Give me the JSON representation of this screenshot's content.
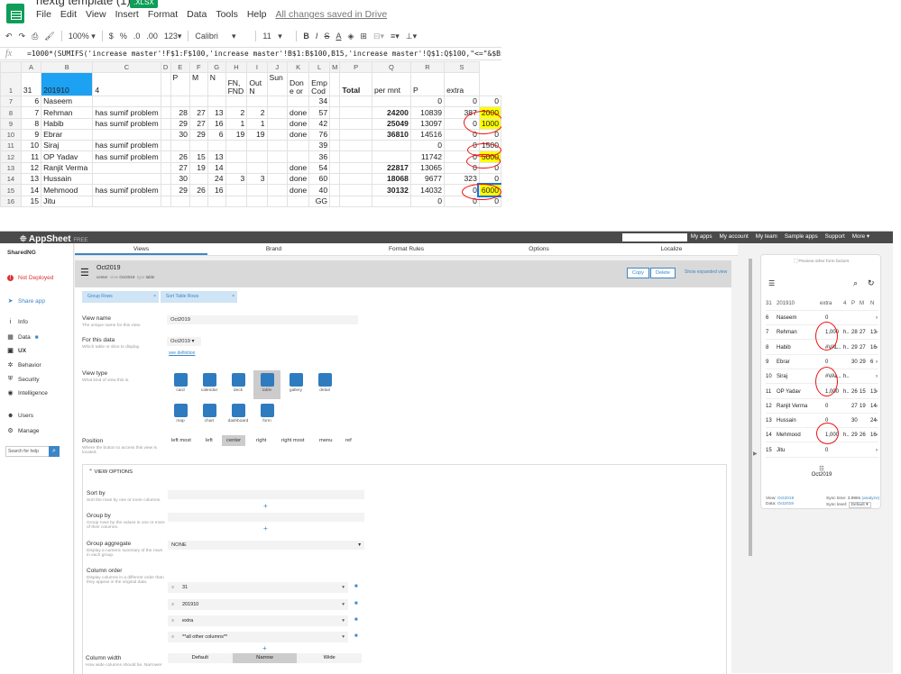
{
  "sheets": {
    "doc_title": "nextg template (1)",
    "doc_ext": ".XLSX",
    "menu": [
      "File",
      "Edit",
      "View",
      "Insert",
      "Format",
      "Data",
      "Tools",
      "Help"
    ],
    "saved_status": "All changes saved in Drive",
    "toolbar": {
      "zoom": "100%",
      "currency": "$",
      "percent": "%",
      "dec_less": ".0",
      "dec_more": ".00",
      "format": "123",
      "font": "Calibri",
      "size": "11",
      "bold": "B",
      "italic": "I",
      "strike": "S",
      "color": "A"
    },
    "formula": "=1000*(SUMIFS('increase master'!F$1:F$100,'increase master'!B$1:B$100,B15,'increase master'!Q$1:Q$100,\"<=\"&$B$1))",
    "columns": [
      "A",
      "B",
      "C",
      "D",
      "E",
      "F",
      "G",
      "H",
      "I",
      "J",
      "K",
      "L",
      "M",
      "P",
      "Q",
      "R",
      "S"
    ],
    "header_row": {
      "rn": "1",
      "A": "31",
      "B": "201910",
      "C": "4",
      "E": "P",
      "F": "M",
      "G": "N",
      "H": "FN, FND",
      "I": "Out N",
      "J": "Sun",
      "K": "Don e or",
      "L": "Emp Cod",
      "P": "Total",
      "Q": "per mnt",
      "R": "P",
      "S": "extra"
    },
    "rows": [
      {
        "rn": "7",
        "A": "6",
        "B": "Naseem",
        "C": "",
        "E": "",
        "F": "",
        "G": "",
        "H": "",
        "I": "",
        "K": "",
        "L": "34",
        "P": "",
        "Q": "0",
        "R": "0",
        "S": "0"
      },
      {
        "rn": "8",
        "A": "7",
        "B": "Rehman",
        "C": "has sumif problem",
        "E": "28",
        "F": "27",
        "G": "13",
        "H": "2",
        "I": "2",
        "K": "done",
        "L": "57",
        "P": "24200",
        "Q": "10839",
        "R": "387",
        "S": "2000"
      },
      {
        "rn": "9",
        "A": "8",
        "B": "Habib",
        "C": "has sumif problem",
        "E": "29",
        "F": "27",
        "G": "16",
        "H": "1",
        "I": "1",
        "K": "done",
        "L": "42",
        "P": "25049",
        "Q": "13097",
        "R": "0",
        "S": "1000"
      },
      {
        "rn": "10",
        "A": "9",
        "B": "Ebrar",
        "C": "",
        "E": "30",
        "F": "29",
        "G": "6",
        "H": "19",
        "I": "19",
        "K": "done",
        "L": "76",
        "P": "36810",
        "Q": "14516",
        "R": "0",
        "S": "0"
      },
      {
        "rn": "11",
        "A": "10",
        "B": "Siraj",
        "C": "has sumif problem",
        "E": "",
        "F": "",
        "G": "",
        "H": "",
        "I": "",
        "K": "",
        "L": "39",
        "P": "",
        "Q": "0",
        "R": "0",
        "S": "1500"
      },
      {
        "rn": "12",
        "A": "11",
        "B": "OP Yadav",
        "C": "has sumif problem",
        "E": "26",
        "F": "15",
        "G": "13",
        "H": "",
        "I": "",
        "K": "",
        "L": "36",
        "P": "",
        "Q": "11742",
        "R": "0",
        "S": "5000"
      },
      {
        "rn": "13",
        "A": "12",
        "B": "Ranjit Verma",
        "C": "",
        "E": "27",
        "F": "19",
        "G": "14",
        "H": "",
        "I": "",
        "K": "done",
        "L": "54",
        "P": "22817",
        "Q": "13065",
        "R": "0",
        "S": "0"
      },
      {
        "rn": "14",
        "A": "13",
        "B": "Hussain",
        "C": "",
        "E": "30",
        "F": "",
        "G": "24",
        "H": "3",
        "I": "3",
        "K": "done",
        "L": "60",
        "P": "18068",
        "Q": "9677",
        "R": "323",
        "S": "0"
      },
      {
        "rn": "15",
        "A": "14",
        "B": "Mehmood",
        "C": "has sumif problem",
        "E": "29",
        "F": "26",
        "G": "16",
        "H": "",
        "I": "",
        "K": "done",
        "L": "40",
        "P": "30132",
        "Q": "14032",
        "R": "0",
        "S": "6000"
      },
      {
        "rn": "16",
        "A": "15",
        "B": "Jitu",
        "C": "",
        "E": "",
        "F": "",
        "G": "",
        "H": "",
        "I": "",
        "K": "",
        "L": "GG",
        "P": "",
        "Q": "0",
        "R": "0",
        "S": "0"
      }
    ]
  },
  "app": {
    "brand": "AppSheet",
    "brand_tag": "FREE",
    "top_links": [
      "My apps",
      "My account",
      "My team",
      "Sample apps",
      "Support",
      "More ▾"
    ],
    "app_name": "SharedNG",
    "nav": [
      {
        "label": "Not Deployed",
        "icon": "!"
      },
      {
        "label": "Share app",
        "icon": "➤"
      },
      {
        "label": "Info",
        "icon": "i"
      },
      {
        "label": "Data",
        "icon": "▦"
      },
      {
        "label": "UX",
        "icon": "▣"
      },
      {
        "label": "Behavior",
        "icon": "✲"
      },
      {
        "label": "Security",
        "icon": "⛨"
      },
      {
        "label": "Intelligence",
        "icon": "◉"
      },
      {
        "label": "Users",
        "icon": "☻"
      },
      {
        "label": "Manage",
        "icon": "⚙"
      }
    ],
    "search_help": "Search for help",
    "tabs": [
      "Views",
      "Brand",
      "Format Rules",
      "Options",
      "Localize"
    ],
    "view": {
      "title": "Oct2019",
      "meta_center": "center",
      "meta_view_label": "view",
      "meta_view": "Oct2019",
      "meta_type_label": "type",
      "meta_type": "table",
      "copy": "Copy",
      "delete": "Delete",
      "show_expanded": "Show expanded view",
      "group_rows": "Group Rows",
      "sort_rows": "Sort Table Rows",
      "view_name_label": "View name",
      "view_name_sub": "The unique name for this view.",
      "view_name": "Oct2019",
      "for_data_label": "For this data",
      "for_data_sub": "Which table or slice to display.",
      "for_data": "Oct2019",
      "see_def": "see definition",
      "view_type_label": "View type",
      "view_type_sub": "What kind of view this is.",
      "types": [
        "card",
        "calendar",
        "deck",
        "table",
        "gallery",
        "detail",
        "map",
        "chart",
        "dashboard",
        "form"
      ],
      "position_label": "Position",
      "position_sub": "Where the button to access this view is located.",
      "positions": [
        "left most",
        "left",
        "center",
        "right",
        "right most",
        "menu",
        "ref"
      ],
      "options_hdr": "VIEW OPTIONS",
      "sort_label": "Sort by",
      "sort_sub": "Sort the rows by one or more columns.",
      "group_label": "Group by",
      "group_sub": "Group rows by the values in one or more of their columns.",
      "agg_label": "Group aggregate",
      "agg_sub": "Display a numeric summary of the rows in each group.",
      "agg": "NONE",
      "colorder_label": "Column order",
      "colorder_sub": "Display columns in a different order than they appear in the original data.",
      "columns": [
        "31",
        "201910",
        "extra",
        "**all other columns**"
      ],
      "colwidth_label": "Column width",
      "colwidth_sub": "How wide columns should be. Narrower",
      "widths": [
        "Default",
        "Narrow",
        "Wide"
      ]
    },
    "preview": {
      "link": "Preview other form factors",
      "header": {
        "a": "31",
        "b": "201910",
        "c": "extra",
        "d": "4",
        "e": "P",
        "f": "M",
        "g": "N"
      },
      "rows": [
        {
          "a": "6",
          "b": "Naseem",
          "c": "0",
          "d": "",
          "e": "",
          "f": "",
          "g": ""
        },
        {
          "a": "7",
          "b": "Rehman",
          "c": "1,000",
          "d": "h..",
          "e": "28",
          "f": "27",
          "g": "13"
        },
        {
          "a": "8",
          "b": "Habib",
          "c": "#VAL..",
          "d": "h..",
          "e": "29",
          "f": "27",
          "g": "16"
        },
        {
          "a": "9",
          "b": "Ebrar",
          "c": "0",
          "d": "",
          "e": "30",
          "f": "29",
          "g": "6"
        },
        {
          "a": "10",
          "b": "Siraj",
          "c": "#VAL..",
          "d": "h..",
          "e": "",
          "f": "",
          "g": ""
        },
        {
          "a": "11",
          "b": "OP Yadav",
          "c": "1,000",
          "d": "h..",
          "e": "26",
          "f": "15",
          "g": "13"
        },
        {
          "a": "12",
          "b": "Ranjit Verma",
          "c": "0",
          "d": "",
          "e": "27",
          "f": "19",
          "g": "14"
        },
        {
          "a": "13",
          "b": "Hussain",
          "c": "0",
          "d": "",
          "e": "30",
          "f": "",
          "g": "24"
        },
        {
          "a": "14",
          "b": "Mehmood",
          "c": "1,000",
          "d": "h..",
          "e": "29",
          "f": "26",
          "g": "16"
        },
        {
          "a": "15",
          "b": "Jitu",
          "c": "0",
          "d": "",
          "e": "",
          "f": "",
          "g": ""
        }
      ],
      "view_label": "Oct2019",
      "foot_view": "View:",
      "foot_view_val": "Oct2019",
      "foot_data": "Data:",
      "foot_data_val": "Oct2019",
      "sync_time": "Sync time: 3.998s",
      "analyze": "(analyze)",
      "sync_level": "Sync level:",
      "sync_val": "Default"
    }
  }
}
